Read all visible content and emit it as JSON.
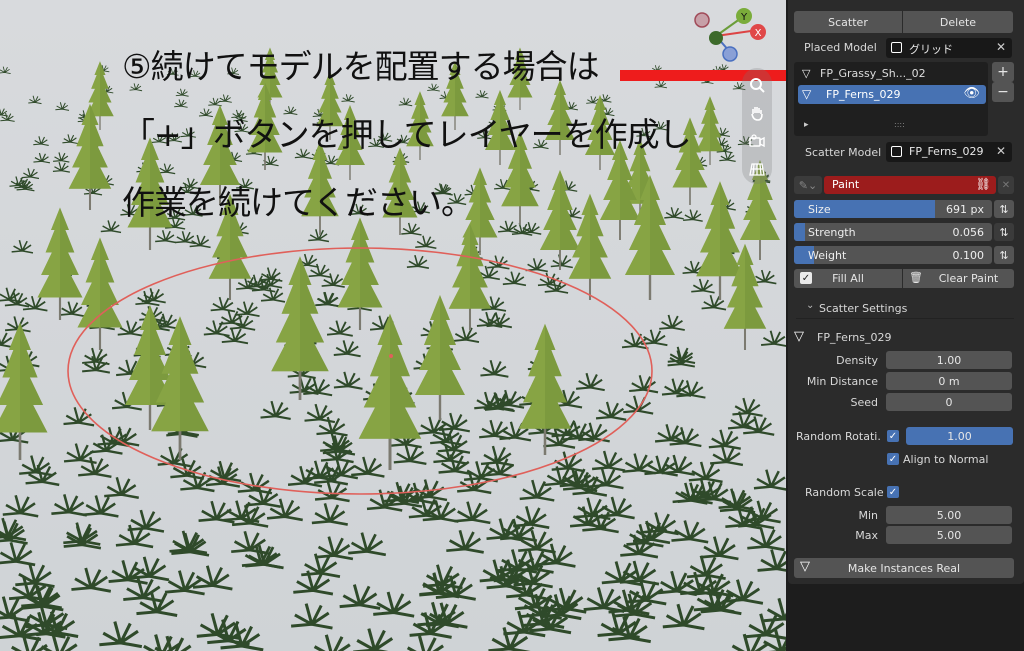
{
  "annotation": {
    "line1": "⑤続けてモデルを配置する場合は",
    "line2": "「+」ボタンを押してレイヤーを作成し",
    "line3": "作業を続けてください。"
  },
  "gizmo": {
    "x_label": "X",
    "y_label": "Y",
    "z_label": "Z"
  },
  "navigation": {
    "zoom_icon": "zoom-icon",
    "pan_icon": "hand-icon",
    "camera_icon": "camera-icon",
    "grid_icon": "grid-icon"
  },
  "panel": {
    "scatter_label": "Scatter",
    "delete_label": "Delete",
    "placed_model_label": "Placed  Model",
    "placed_model_value": "グリッド",
    "layers": [
      {
        "name": "FP_Grassy_Sh..._02",
        "selected": false
      },
      {
        "name": "FP_Ferns_029",
        "selected": true
      }
    ],
    "add_label": "+",
    "remove_label": "−",
    "expand_label": "▸",
    "grip_label": "::::",
    "scatter_model_label": "Scatter Model",
    "scatter_model_value": "FP_Ferns_029",
    "paint_label": "Paint",
    "size_label": "Size",
    "size_value": "691 px",
    "size_fraction": 0.71,
    "strength_label": "Strength",
    "strength_value": "0.056",
    "strength_fraction": 0.056,
    "weight_label": "Weight",
    "weight_value": "0.100",
    "weight_fraction": 0.1,
    "fill_all_label": "Fill All",
    "clear_paint_label": "Clear Paint",
    "scatter_settings_label": "Scatter Settings",
    "object_name": "FP_Ferns_029",
    "density_label": "Density",
    "density_value": "1.00",
    "min_distance_label": "Min Distance",
    "min_distance_value": "0 m",
    "seed_label": "Seed",
    "seed_value": "0",
    "random_rotation_label": "Random Rotati...",
    "random_rotation_value": "1.00",
    "align_to_normal_label": "Align to Normal",
    "random_scale_label": "Random Scale",
    "min_label": "Min",
    "min_value": "5.00",
    "max_label": "Max",
    "max_value": "5.00",
    "make_instances_real_label": "Make Instances Real"
  },
  "colors": {
    "accent": "#4772b3",
    "paint_red": "#9c1c1c",
    "arrow_red": "#ee1c1c",
    "brush_circle": "#e0605a"
  }
}
